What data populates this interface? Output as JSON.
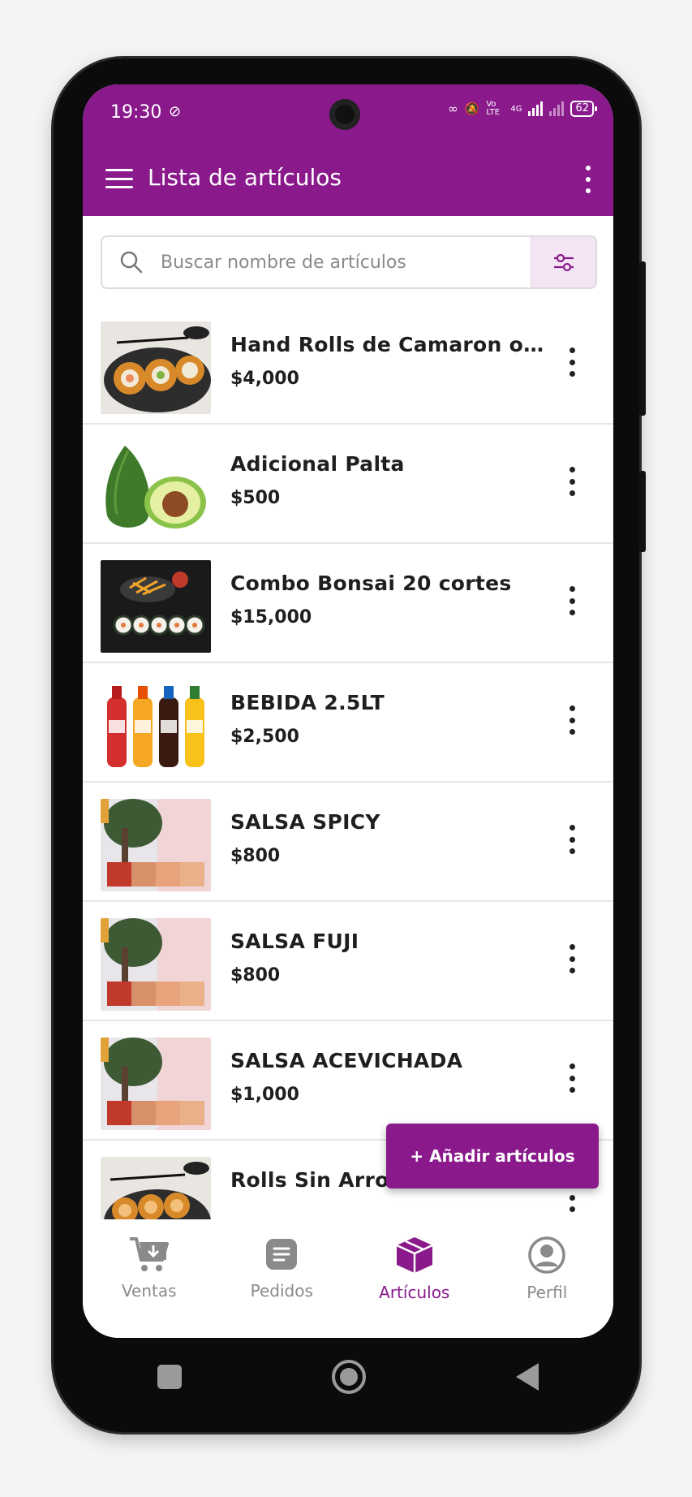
{
  "status_bar": {
    "time": "19:30",
    "network": "4G",
    "volte": "Vo LTE",
    "battery": "62"
  },
  "app_bar": {
    "title": "Lista de artículos"
  },
  "search": {
    "placeholder": "Buscar nombre de artículos"
  },
  "items": [
    {
      "name": "Hand Rolls de Camaron o S...",
      "price": "$4,000"
    },
    {
      "name": "Adicional Palta",
      "price": "$500"
    },
    {
      "name": "Combo Bonsai 20 cortes",
      "price": "$15,000"
    },
    {
      "name": "BEBIDA 2.5LT",
      "price": "$2,500"
    },
    {
      "name": "SALSA SPICY",
      "price": "$800"
    },
    {
      "name": "SALSA FUJI",
      "price": "$800"
    },
    {
      "name": "SALSA ACEVICHADA",
      "price": "$1,000"
    },
    {
      "name": "Rolls Sin Arroz Adicional",
      "price": ""
    }
  ],
  "fab": {
    "label": "+ Añadir artículos"
  },
  "bottom_nav": [
    {
      "label": "Ventas",
      "icon": "cart-icon",
      "active": false
    },
    {
      "label": "Pedidos",
      "icon": "document-icon",
      "active": false
    },
    {
      "label": "Artículos",
      "icon": "box-icon",
      "active": true
    },
    {
      "label": "Perfil",
      "icon": "profile-icon",
      "active": false
    }
  ],
  "colors": {
    "primary": "#8a1a8c",
    "filter_bg": "#f3e5f4",
    "inactive": "#8a8a8a"
  }
}
